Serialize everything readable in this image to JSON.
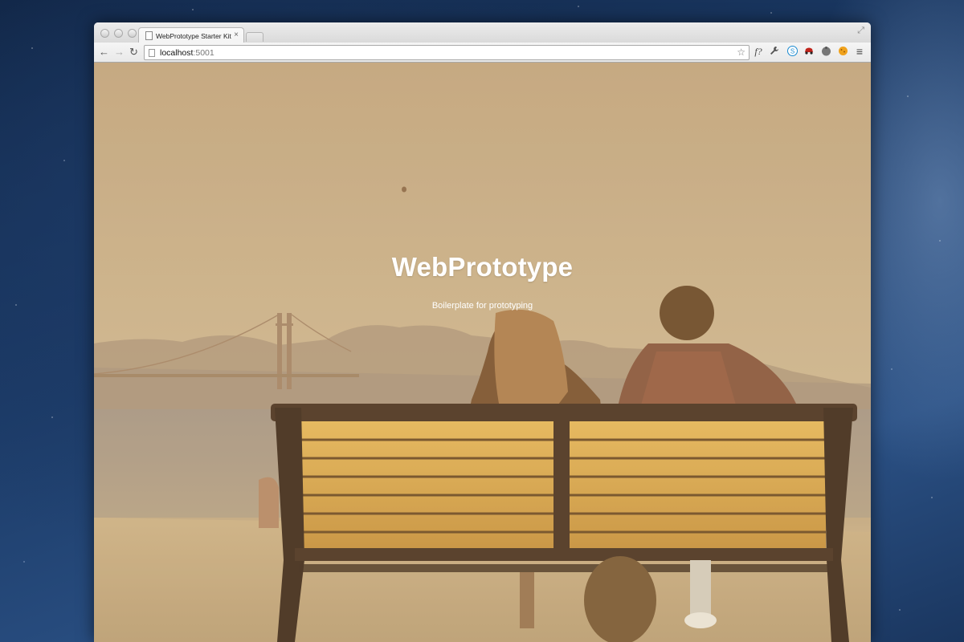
{
  "browser": {
    "tab": {
      "title": "WebPrototype Starter Kit",
      "close_glyph": "×"
    },
    "url": {
      "host": "localhost",
      "port": ":5001"
    },
    "nav": {
      "back": "←",
      "forward": "→",
      "reload": "↻"
    },
    "extensions": [
      {
        "icon": "fquery-icon",
        "glyph": "f?"
      },
      {
        "icon": "wrench-icon",
        "glyph": "🔧"
      },
      {
        "icon": "skype-icon",
        "glyph": "S"
      },
      {
        "icon": "red-car-icon",
        "glyph": "●"
      },
      {
        "icon": "gray-blob-icon",
        "glyph": "●"
      },
      {
        "icon": "cookie-icon",
        "glyph": "●"
      },
      {
        "icon": "menu-icon",
        "glyph": "≡"
      }
    ],
    "bookmark_glyph": "☆"
  },
  "hero": {
    "title": "WebPrototype",
    "subtitle": "Boilerplate for prototyping"
  }
}
